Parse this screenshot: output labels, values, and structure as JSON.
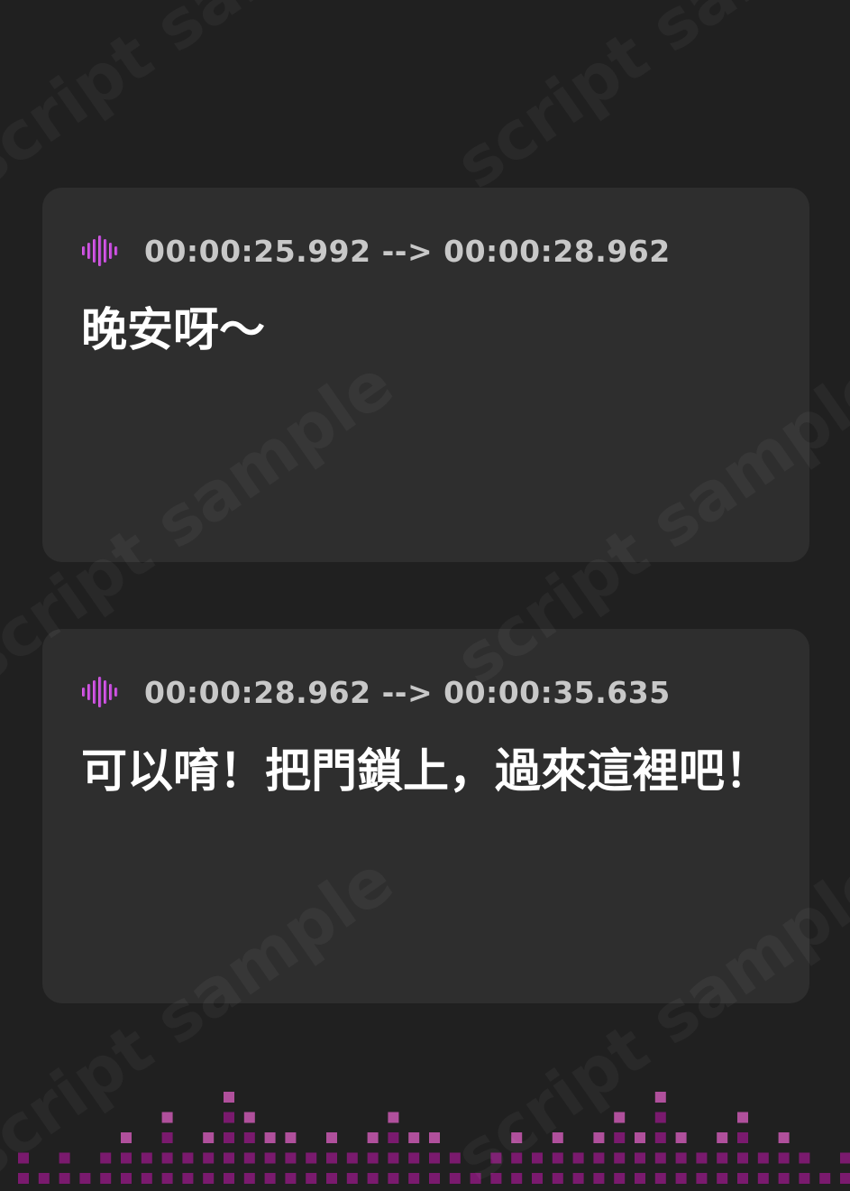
{
  "watermark": "script sample",
  "cues": [
    {
      "icon": "sound-wave-icon",
      "timestamp": "00:00:25.992 --> 00:00:28.962",
      "text": "晚安呀～"
    },
    {
      "icon": "sound-wave-icon",
      "timestamp": "00:00:28.962 --> 00:00:35.635",
      "text": "可以唷！把門鎖上，過來這裡吧！"
    }
  ],
  "colors": {
    "background": "#202020",
    "card": "#2e2e2e",
    "timestamp": "#c8c8c8",
    "text": "#ffffff",
    "accent_light": "#e060e8",
    "accent_dark": "#a83ac8",
    "equalizer_bright": "#b0509c",
    "equalizer_dark": "#7a1a6e"
  }
}
